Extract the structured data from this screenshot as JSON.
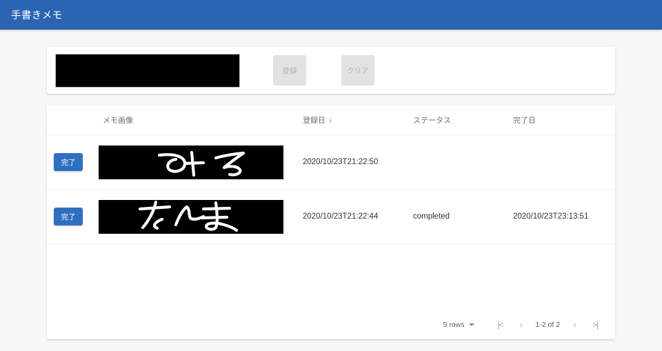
{
  "app": {
    "title": "手書きメモ",
    "header_bg": "#2c64b4"
  },
  "editor": {
    "canvas_label": "handwriting-canvas",
    "register_button": "登録",
    "clear_button": "クリア",
    "buttons_disabled": true
  },
  "table": {
    "columns": [
      {
        "key": "action",
        "label": ""
      },
      {
        "key": "image",
        "label": "メモ画像"
      },
      {
        "key": "regdate",
        "label": "登録日",
        "sort": "↓"
      },
      {
        "key": "status",
        "label": "ステータス"
      },
      {
        "key": "donedate",
        "label": "完了日"
      }
    ],
    "rows": [
      {
        "action_label": "完了",
        "image_alt": "みそ",
        "regdate": "2020/10/23T21:22:50",
        "status": "",
        "donedate": ""
      },
      {
        "action_label": "完了",
        "image_alt": "さんま",
        "regdate": "2020/10/23T21:22:44",
        "status": "completed",
        "donedate": "2020/10/23T23:13:51"
      }
    ]
  },
  "pagination": {
    "rows_per_page": "5 rows",
    "range_label": "1-2 of 2",
    "first_icon": "|<",
    "prev_icon": "‹",
    "next_icon": "›",
    "last_icon": ">|"
  },
  "colors": {
    "accent": "#2f6fc0",
    "page_bg": "#f7f7f7",
    "disabled_bg": "#e2e2e2"
  }
}
